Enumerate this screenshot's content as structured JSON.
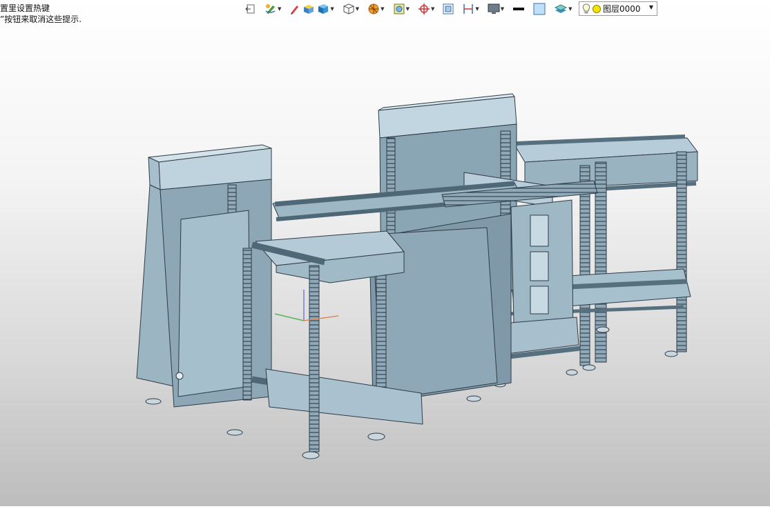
{
  "hint": {
    "line1": "置里设置热键",
    "line2": "”按钮来取消这些提示."
  },
  "toolbar": {
    "items": [
      {
        "name": "exit-view-icon",
        "dropdown": false
      },
      {
        "name": "sketch-pen-icon",
        "dropdown": true
      },
      {
        "name": "pencil-icon",
        "dropdown": false
      },
      {
        "name": "box-color-icon",
        "dropdown": false
      },
      {
        "name": "shaded-cube-icon",
        "dropdown": true
      },
      {
        "name": "wireframe-cube-icon",
        "dropdown": true
      },
      {
        "name": "section-sphere-icon",
        "dropdown": true
      },
      {
        "name": "zoom-frame-icon",
        "dropdown": true
      },
      {
        "name": "crosshair-icon",
        "dropdown": true
      },
      {
        "name": "fit-window-icon",
        "dropdown": false
      },
      {
        "name": "dimension-icon",
        "dropdown": true
      },
      {
        "name": "screen-display-icon",
        "dropdown": true
      },
      {
        "name": "line-style-icon",
        "dropdown": false
      },
      {
        "name": "fill-color-icon",
        "dropdown": false
      },
      {
        "name": "layers-icon",
        "dropdown": true
      }
    ]
  },
  "layer": {
    "label": "图层0000",
    "color": "#f2e600"
  },
  "colors": {
    "model_fill": "#a9c3d2",
    "model_dark": "#7d97a6",
    "model_light": "#c6dae5",
    "edge": "#2d3a44"
  }
}
